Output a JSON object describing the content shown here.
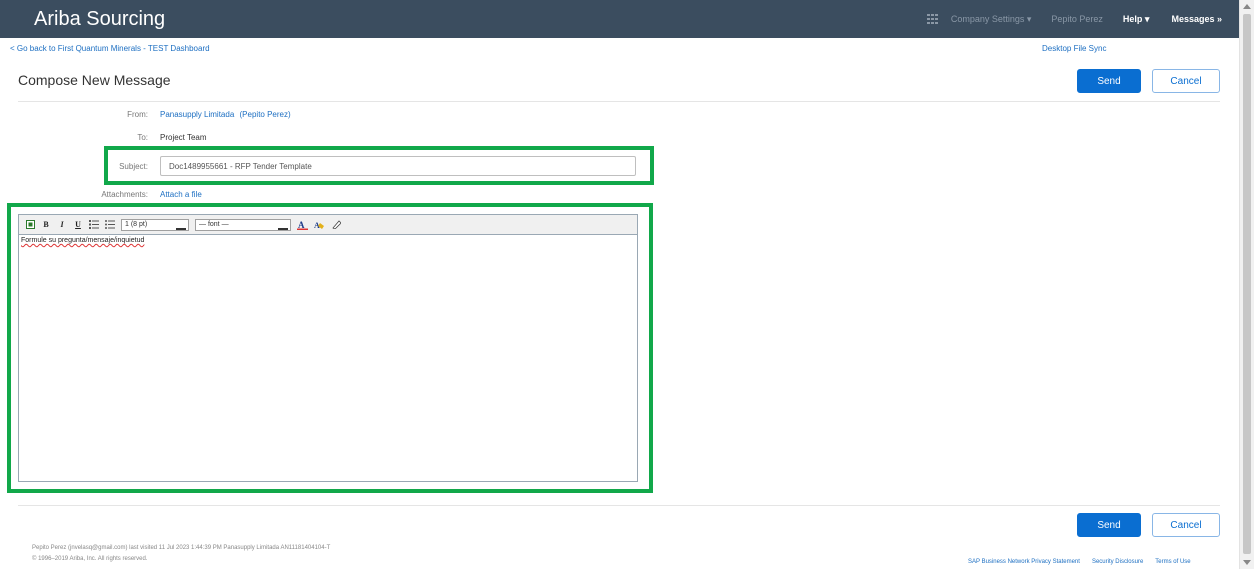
{
  "header": {
    "brand": "Ariba Sourcing",
    "nav": {
      "company_settings": "Company Settings ▾",
      "user": "Pepito Perez",
      "help": "Help ▾",
      "messages": "Messages »"
    }
  },
  "links": {
    "back": "< Go back to First Quantum Minerals - TEST Dashboard",
    "desktop_sync": "Desktop File Sync"
  },
  "page": {
    "title": "Compose New Message",
    "send_label": "Send",
    "cancel_label": "Cancel"
  },
  "form": {
    "from_label": "From:",
    "from_value": "Panasupply Limitada",
    "from_user": "(Pepito Perez)",
    "to_label": "To:",
    "to_value": "Project Team",
    "subject_label": "Subject:",
    "subject_value": "Doc1489955661 - RFP Tender Template",
    "attachments_label": "Attachments:",
    "attach_link": "Attach a file"
  },
  "editor": {
    "toolbar": {
      "bold": "B",
      "italic": "I",
      "underline": "U",
      "size": "1 (8 pt)",
      "font": "— font —"
    },
    "body_text": "Formule su pregunta/mensaje/inquietud"
  },
  "footer": {
    "last_visited": "Pepito Perez (jnvelasq@gmail.com) last visited 11 Jul 2023 1:44:39 PM  Panasupply Limitada  AN11181404104-T",
    "copyright": "© 1996–2019 Ariba, Inc. All rights reserved.",
    "privacy": "SAP Business Network Privacy Statement",
    "security": "Security Disclosure",
    "terms": "Terms of Use"
  },
  "colors": {
    "topbar": "#3b4d5f",
    "primary": "#0a6ed1",
    "highlight": "#11a84a"
  }
}
